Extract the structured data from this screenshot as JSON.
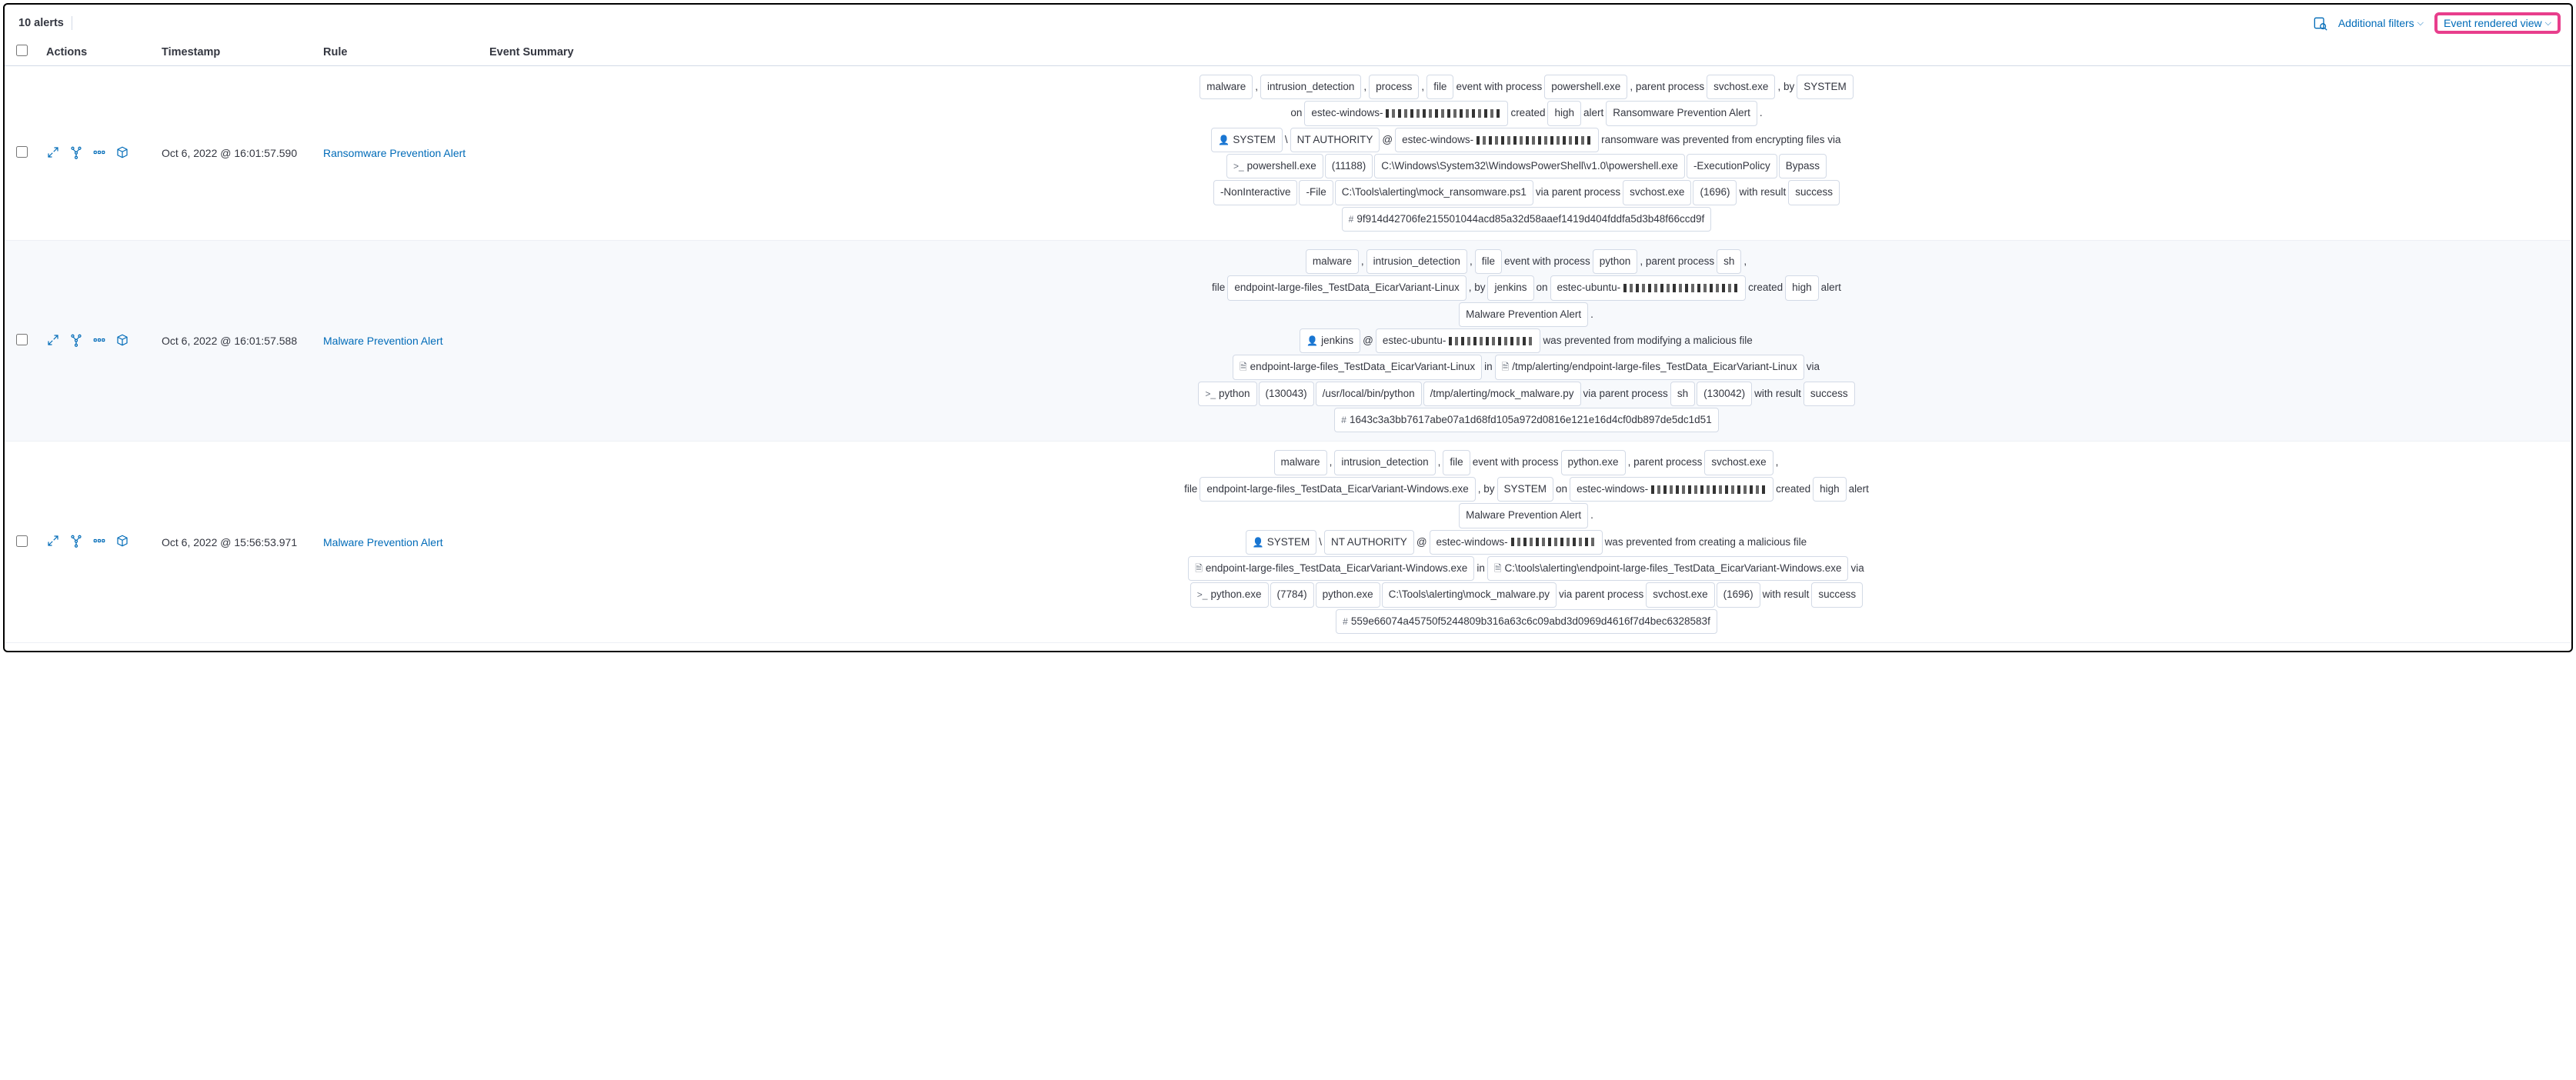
{
  "header": {
    "alert_count": "10 alerts",
    "additional_filters": "Additional filters",
    "event_rendered_view": "Event rendered view"
  },
  "columns": {
    "actions": "Actions",
    "timestamp": "Timestamp",
    "rule": "Rule",
    "summary": "Event Summary"
  },
  "rows": [
    {
      "timestamp": "Oct 6, 2022 @ 16:01:57.590",
      "rule": "Ransomware Prevention Alert",
      "summary": [
        {
          "t": "token",
          "v": "malware"
        },
        {
          "t": "plain",
          "v": ","
        },
        {
          "t": "token",
          "v": "intrusion_detection"
        },
        {
          "t": "plain",
          "v": ","
        },
        {
          "t": "token",
          "v": "process"
        },
        {
          "t": "plain",
          "v": ","
        },
        {
          "t": "token",
          "v": "file"
        },
        {
          "t": "plain",
          "v": "event with process"
        },
        {
          "t": "token",
          "v": "powershell.exe"
        },
        {
          "t": "plain",
          "v": ", parent process"
        },
        {
          "t": "token",
          "v": "svchost.exe"
        },
        {
          "t": "plain",
          "v": ", by"
        },
        {
          "t": "token",
          "v": "SYSTEM"
        },
        {
          "t": "br"
        },
        {
          "t": "plain",
          "v": "on"
        },
        {
          "t": "token",
          "v": "estec-windows-",
          "obf": true
        },
        {
          "t": "plain",
          "v": "created"
        },
        {
          "t": "token",
          "v": "high"
        },
        {
          "t": "plain",
          "v": "alert"
        },
        {
          "t": "token",
          "v": "Ransomware Prevention Alert"
        },
        {
          "t": "plain",
          "v": "."
        },
        {
          "t": "br"
        },
        {
          "t": "token",
          "icon": "user",
          "v": "SYSTEM"
        },
        {
          "t": "plain",
          "v": "\\"
        },
        {
          "t": "token",
          "v": "NT AUTHORITY"
        },
        {
          "t": "plain",
          "v": "@"
        },
        {
          "t": "token",
          "v": "estec-windows-",
          "obf": true
        },
        {
          "t": "plain",
          "v": "ransomware was prevented from encrypting files via"
        },
        {
          "t": "br"
        },
        {
          "t": "token",
          "icon": "term",
          "v": "powershell.exe"
        },
        {
          "t": "token",
          "v": "(11188)"
        },
        {
          "t": "token",
          "v": "C:\\Windows\\System32\\WindowsPowerShell\\v1.0\\powershell.exe"
        },
        {
          "t": "token",
          "v": "-ExecutionPolicy"
        },
        {
          "t": "token",
          "v": "Bypass"
        },
        {
          "t": "br"
        },
        {
          "t": "token",
          "v": "-NonInteractive"
        },
        {
          "t": "token",
          "v": "-File"
        },
        {
          "t": "token",
          "v": "C:\\Tools\\alerting\\mock_ransomware.ps1"
        },
        {
          "t": "plain",
          "v": "via parent process"
        },
        {
          "t": "token",
          "v": "svchost.exe"
        },
        {
          "t": "token",
          "v": "(1696)"
        },
        {
          "t": "plain",
          "v": "with result"
        },
        {
          "t": "token",
          "v": "success"
        },
        {
          "t": "br"
        },
        {
          "t": "token",
          "icon": "hash",
          "v": "9f914d42706fe215501044acd85a32d58aaef1419d404fddfa5d3b48f66ccd9f"
        }
      ]
    },
    {
      "timestamp": "Oct 6, 2022 @ 16:01:57.588",
      "rule": "Malware Prevention Alert",
      "alt": true,
      "summary": [
        {
          "t": "token",
          "v": "malware"
        },
        {
          "t": "plain",
          "v": ","
        },
        {
          "t": "token",
          "v": "intrusion_detection"
        },
        {
          "t": "plain",
          "v": ","
        },
        {
          "t": "token",
          "v": "file"
        },
        {
          "t": "plain",
          "v": "event with process"
        },
        {
          "t": "token",
          "v": "python"
        },
        {
          "t": "plain",
          "v": ", parent process"
        },
        {
          "t": "token",
          "v": "sh"
        },
        {
          "t": "plain",
          "v": ","
        },
        {
          "t": "br"
        },
        {
          "t": "plain",
          "v": "file"
        },
        {
          "t": "token",
          "v": "endpoint-large-files_TestData_EicarVariant-Linux"
        },
        {
          "t": "plain",
          "v": ", by"
        },
        {
          "t": "token",
          "v": "jenkins"
        },
        {
          "t": "plain",
          "v": "on"
        },
        {
          "t": "token",
          "v": "estec-ubuntu-",
          "obf": true
        },
        {
          "t": "plain",
          "v": "created"
        },
        {
          "t": "token",
          "v": "high"
        },
        {
          "t": "plain",
          "v": "alert"
        },
        {
          "t": "br"
        },
        {
          "t": "token",
          "v": "Malware Prevention Alert"
        },
        {
          "t": "plain",
          "v": "."
        },
        {
          "t": "br"
        },
        {
          "t": "token",
          "icon": "user",
          "v": "jenkins"
        },
        {
          "t": "plain",
          "v": "@"
        },
        {
          "t": "token",
          "v": "estec-ubuntu-",
          "obf": "sm"
        },
        {
          "t": "plain",
          "v": "was prevented from modifying a malicious file"
        },
        {
          "t": "br"
        },
        {
          "t": "token",
          "icon": "file",
          "v": "endpoint-large-files_TestData_EicarVariant-Linux"
        },
        {
          "t": "plain",
          "v": "in"
        },
        {
          "t": "token",
          "icon": "file",
          "v": "/tmp/alerting/endpoint-large-files_TestData_EicarVariant-Linux"
        },
        {
          "t": "plain",
          "v": "via"
        },
        {
          "t": "br"
        },
        {
          "t": "token",
          "icon": "term",
          "v": "python"
        },
        {
          "t": "token",
          "v": "(130043)"
        },
        {
          "t": "token",
          "v": "/usr/local/bin/python"
        },
        {
          "t": "token",
          "v": "/tmp/alerting/mock_malware.py"
        },
        {
          "t": "plain",
          "v": "via parent process"
        },
        {
          "t": "token",
          "v": "sh"
        },
        {
          "t": "token",
          "v": "(130042)"
        },
        {
          "t": "plain",
          "v": "with result"
        },
        {
          "t": "token",
          "v": "success"
        },
        {
          "t": "br"
        },
        {
          "t": "token",
          "icon": "hash",
          "v": "1643c3a3bb7617abe07a1d68fd105a972d0816e121e16d4cf0db897de5dc1d51"
        }
      ]
    },
    {
      "timestamp": "Oct 6, 2022 @ 15:56:53.971",
      "rule": "Malware Prevention Alert",
      "summary": [
        {
          "t": "token",
          "v": "malware"
        },
        {
          "t": "plain",
          "v": ","
        },
        {
          "t": "token",
          "v": "intrusion_detection"
        },
        {
          "t": "plain",
          "v": ","
        },
        {
          "t": "token",
          "v": "file"
        },
        {
          "t": "plain",
          "v": "event with process"
        },
        {
          "t": "token",
          "v": "python.exe"
        },
        {
          "t": "plain",
          "v": ", parent process"
        },
        {
          "t": "token",
          "v": "svchost.exe"
        },
        {
          "t": "plain",
          "v": ","
        },
        {
          "t": "br"
        },
        {
          "t": "plain",
          "v": "file"
        },
        {
          "t": "token",
          "v": "endpoint-large-files_TestData_EicarVariant-Windows.exe"
        },
        {
          "t": "plain",
          "v": ", by"
        },
        {
          "t": "token",
          "v": "SYSTEM"
        },
        {
          "t": "plain",
          "v": "on"
        },
        {
          "t": "token",
          "v": "estec-windows-",
          "obf": true
        },
        {
          "t": "plain",
          "v": "created"
        },
        {
          "t": "token",
          "v": "high"
        },
        {
          "t": "plain",
          "v": "alert"
        },
        {
          "t": "br"
        },
        {
          "t": "token",
          "v": "Malware Prevention Alert"
        },
        {
          "t": "plain",
          "v": "."
        },
        {
          "t": "br"
        },
        {
          "t": "token",
          "icon": "user",
          "v": "SYSTEM"
        },
        {
          "t": "plain",
          "v": "\\"
        },
        {
          "t": "token",
          "v": "NT AUTHORITY"
        },
        {
          "t": "plain",
          "v": "@"
        },
        {
          "t": "token",
          "v": "estec-windows-",
          "obf": "sm"
        },
        {
          "t": "plain",
          "v": "was prevented from creating a malicious file"
        },
        {
          "t": "br"
        },
        {
          "t": "token",
          "icon": "file",
          "v": "endpoint-large-files_TestData_EicarVariant-Windows.exe"
        },
        {
          "t": "plain",
          "v": "in"
        },
        {
          "t": "token",
          "icon": "file",
          "v": "C:\\tools\\alerting\\endpoint-large-files_TestData_EicarVariant-Windows.exe"
        },
        {
          "t": "plain",
          "v": "via"
        },
        {
          "t": "br"
        },
        {
          "t": "token",
          "icon": "term",
          "v": "python.exe"
        },
        {
          "t": "token",
          "v": "(7784)"
        },
        {
          "t": "token",
          "v": "python.exe"
        },
        {
          "t": "token",
          "v": "C:\\Tools\\alerting\\mock_malware.py"
        },
        {
          "t": "plain",
          "v": "via parent process"
        },
        {
          "t": "token",
          "v": "svchost.exe"
        },
        {
          "t": "token",
          "v": "(1696)"
        },
        {
          "t": "plain",
          "v": "with result"
        },
        {
          "t": "token",
          "v": "success"
        },
        {
          "t": "br"
        },
        {
          "t": "token",
          "icon": "hash",
          "v": "559e66074a45750f5244809b316a63c6c09abd3d0969d4616f7d4bec6328583f"
        }
      ]
    }
  ]
}
